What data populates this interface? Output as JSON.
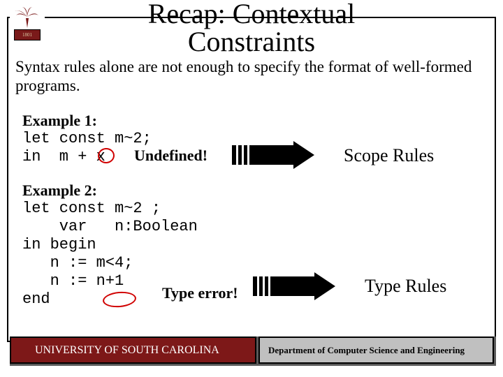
{
  "title_line1": "Recap:  Contextual",
  "title_line2": "Constraints",
  "intro": "Syntax rules alone are not enough to specify the format of well-formed programs.",
  "example1": {
    "label": "Example 1:",
    "code": "let const m~2;\nin  m + x",
    "callout": "Undefined!",
    "result": "Scope Rules"
  },
  "example2": {
    "label": "Example 2:",
    "code": "let const m~2 ;\n    var   n:Boolean\nin begin\n   n := m<4;\n   n := n+1\nend",
    "callout": "Type error!",
    "result": "Type Rules"
  },
  "footer": {
    "left": "UNIVERSITY OF SOUTH CAROLINA",
    "right": "Department of Computer Science and Engineering"
  },
  "logo_year": "1801"
}
